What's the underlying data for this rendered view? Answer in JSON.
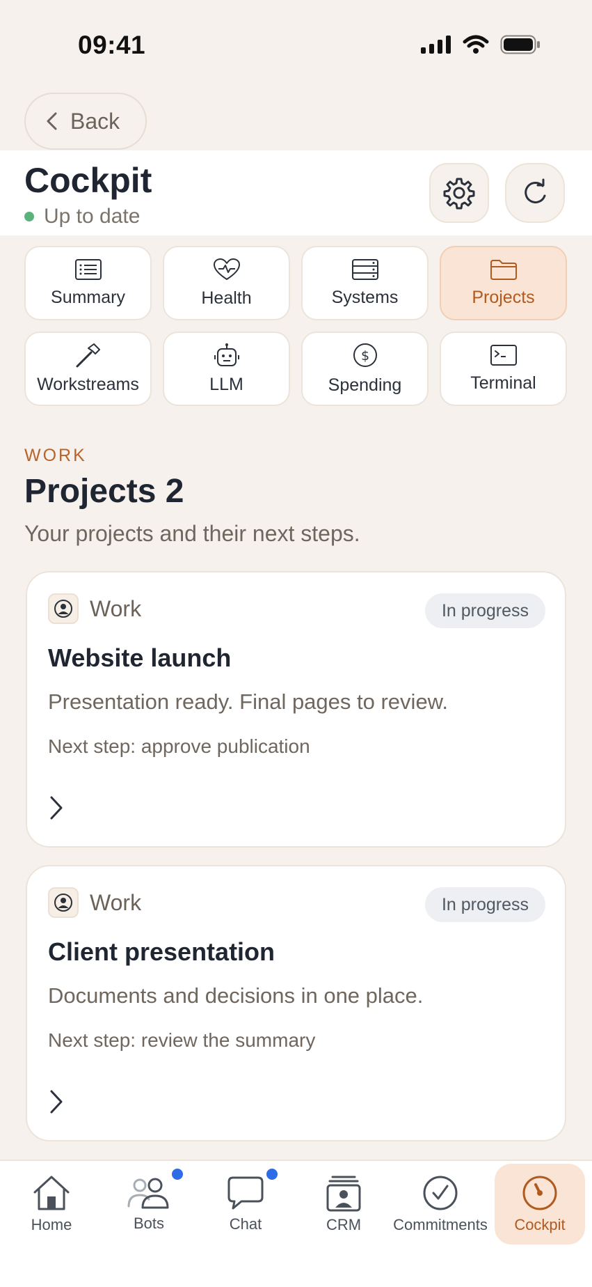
{
  "status_bar": {
    "time": "09:41"
  },
  "back": {
    "label": "Back"
  },
  "header": {
    "title": "Cockpit",
    "status": "Up to date"
  },
  "tabs": [
    {
      "label": "Summary",
      "icon": "list-icon",
      "active": false
    },
    {
      "label": "Health",
      "icon": "heart-pulse-icon",
      "active": false
    },
    {
      "label": "Systems",
      "icon": "server-icon",
      "active": false
    },
    {
      "label": "Projects",
      "icon": "folder-icon",
      "active": true
    },
    {
      "label": "Workstreams",
      "icon": "hammer-icon",
      "active": false
    },
    {
      "label": "LLM",
      "icon": "robot-icon",
      "active": false
    },
    {
      "label": "Spending",
      "icon": "dollar-icon",
      "active": false
    },
    {
      "label": "Terminal",
      "icon": "terminal-icon",
      "active": false
    }
  ],
  "section": {
    "eyebrow": "WORK",
    "title": "Projects 2",
    "subtitle": "Your projects and their next steps."
  },
  "projects": [
    {
      "category": "Work",
      "status": "In progress",
      "title": "Website launch",
      "description": "Presentation ready. Final pages to review.",
      "next_step": "Next step: approve publication"
    },
    {
      "category": "Work",
      "status": "In progress",
      "title": "Client presentation",
      "description": "Documents and decisions in one place.",
      "next_step": "Next step: review the summary"
    }
  ],
  "bottom_nav": [
    {
      "label": "Home",
      "icon": "home-icon",
      "active": false,
      "dot": false
    },
    {
      "label": "Bots",
      "icon": "users-icon",
      "active": false,
      "dot": true
    },
    {
      "label": "Chat",
      "icon": "chat-icon",
      "active": false,
      "dot": true
    },
    {
      "label": "CRM",
      "icon": "contact-card-icon",
      "active": false,
      "dot": false
    },
    {
      "label": "Commitments",
      "icon": "check-circle-icon",
      "active": false,
      "dot": false
    },
    {
      "label": "Cockpit",
      "icon": "gauge-icon",
      "active": true,
      "dot": false
    }
  ],
  "colors": {
    "background": "#f6f1ec",
    "accent": "#b15a1f",
    "accent_bg": "#f9e4d5",
    "status_ok": "#5bb27a",
    "notification": "#2e6be6"
  }
}
